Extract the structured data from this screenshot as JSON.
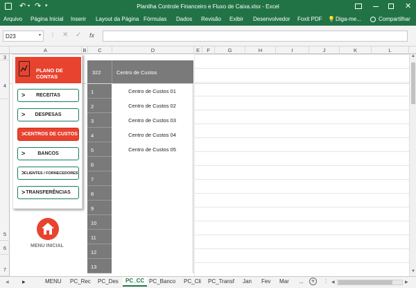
{
  "window": {
    "title": "Planilha Controle Financeiro e Fluxo de Caixa.xlsx - Excel"
  },
  "ribbon": {
    "tabs": [
      "Arquivo",
      "Página Inicial",
      "Inserir",
      "Layout da Página",
      "Fórmulas",
      "Dados",
      "Revisão",
      "Exibir",
      "Desenvolvedor",
      "Foxit PDF"
    ],
    "tell_me": "Diga-me...",
    "share": "Compartilhar"
  },
  "formula_bar": {
    "name_box": "D23",
    "fx_label": "fx",
    "value": ""
  },
  "columns": [
    "A",
    "B",
    "C",
    "D",
    "E",
    "F",
    "G",
    "H",
    "I",
    "J",
    "K",
    "L"
  ],
  "rows": [
    "3",
    "4",
    "5",
    "6",
    "7"
  ],
  "sidebar": {
    "header": "PLANO DE CONTAS",
    "buttons": [
      "RECEITAS",
      "DESPESAS",
      "CENTROS DE CUSTOS",
      "BANCOS",
      "CLIENTES / FORNECEDORES",
      "TRANSFERÊNCIAS"
    ],
    "active_index": 2,
    "arrow": ">",
    "home_label": "MENU INICIAL"
  },
  "table": {
    "header_num": "322",
    "header_label": "Centro de Custos",
    "rows": [
      {
        "num": "1",
        "value": "Centro de Custos 01"
      },
      {
        "num": "2",
        "value": "Centro de Custos 02"
      },
      {
        "num": "3",
        "value": "Centro de Custos 03"
      },
      {
        "num": "4",
        "value": "Centro de Custos 04"
      },
      {
        "num": "5",
        "value": "Centro de Custos 05"
      },
      {
        "num": "6",
        "value": ""
      },
      {
        "num": "7",
        "value": ""
      },
      {
        "num": "8",
        "value": ""
      },
      {
        "num": "9",
        "value": ""
      },
      {
        "num": "10",
        "value": ""
      },
      {
        "num": "11",
        "value": ""
      },
      {
        "num": "12",
        "value": ""
      },
      {
        "num": "13",
        "value": ""
      }
    ]
  },
  "sheet_tabs": [
    "MENU",
    "PC_Rec",
    "PC_Des",
    "PC_CC",
    "PC_Banco",
    "PC_Cli",
    "PC_Transf",
    "Jan",
    "Fev",
    "Mar"
  ],
  "active_sheet": "PC_CC",
  "sheet_more": "...",
  "colors": {
    "excel_green": "#217346",
    "accent_red": "#e8432f",
    "table_gray": "#7a7a7a",
    "button_border": "#1a7a5e"
  }
}
